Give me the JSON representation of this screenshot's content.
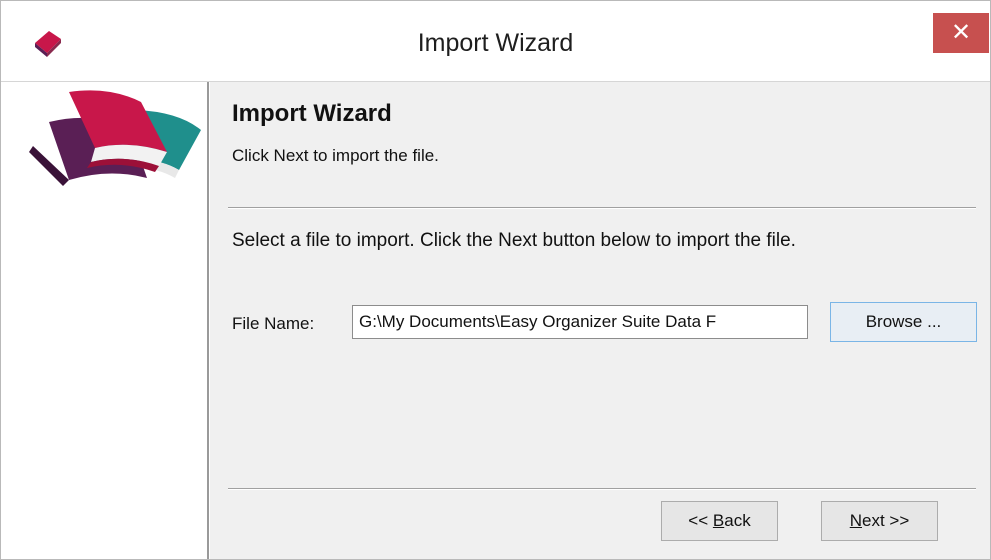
{
  "window": {
    "title": "Import Wizard",
    "close_label": "✕"
  },
  "page": {
    "heading": "Import Wizard",
    "subheading": "Click Next to import the file.",
    "instruction": "Select a file to import.  Click the Next button below to import the file."
  },
  "file": {
    "label": "File Name:",
    "value": "G:\\My Documents\\Easy Organizer Suite Data F",
    "browse_label": "Browse ..."
  },
  "nav": {
    "back_prefix": "<< ",
    "back_mnemonic": "B",
    "back_rest": "ack",
    "next_mnemonic": "N",
    "next_rest": "ext >>"
  },
  "colors": {
    "close_button": "#c7504f",
    "art_red": "#c8174a",
    "art_purple": "#5a1f55",
    "art_teal": "#1f8f8c"
  }
}
